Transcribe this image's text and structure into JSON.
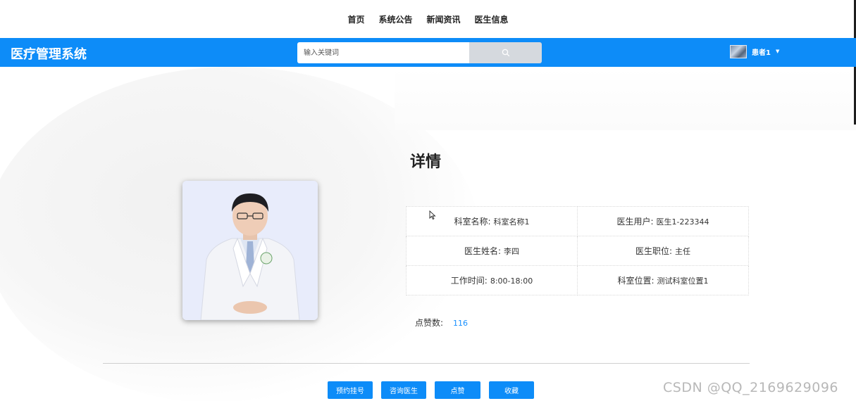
{
  "topnav": {
    "items": [
      "首页",
      "系统公告",
      "新闻资讯",
      "医生信息"
    ]
  },
  "header": {
    "brand": "医疗管理系统",
    "search_placeholder": "输入关键词",
    "username": "患者1"
  },
  "detail": {
    "title": "详情",
    "fields": [
      {
        "label": "科室名称:",
        "value": "科室名称1"
      },
      {
        "label": "医生用户:",
        "value": "医生1-223344"
      },
      {
        "label": "医生姓名:",
        "value": "李四"
      },
      {
        "label": "医生职位:",
        "value": "主任"
      },
      {
        "label": "工作时间:",
        "value": "8:00-18:00"
      },
      {
        "label": "科室位置:",
        "value": "测试科室位置1"
      }
    ],
    "likes_label": "点赞数:",
    "likes_value": "116"
  },
  "actions": {
    "book": "预约挂号",
    "consult": "咨询医生",
    "like": "点赞",
    "favorite": "收藏"
  },
  "watermark": "CSDN @QQ_2169629096",
  "colors": {
    "header_bg": "#0d8cf8",
    "button_bg": "#0d8cf8",
    "likes_value": "#1890ff"
  }
}
